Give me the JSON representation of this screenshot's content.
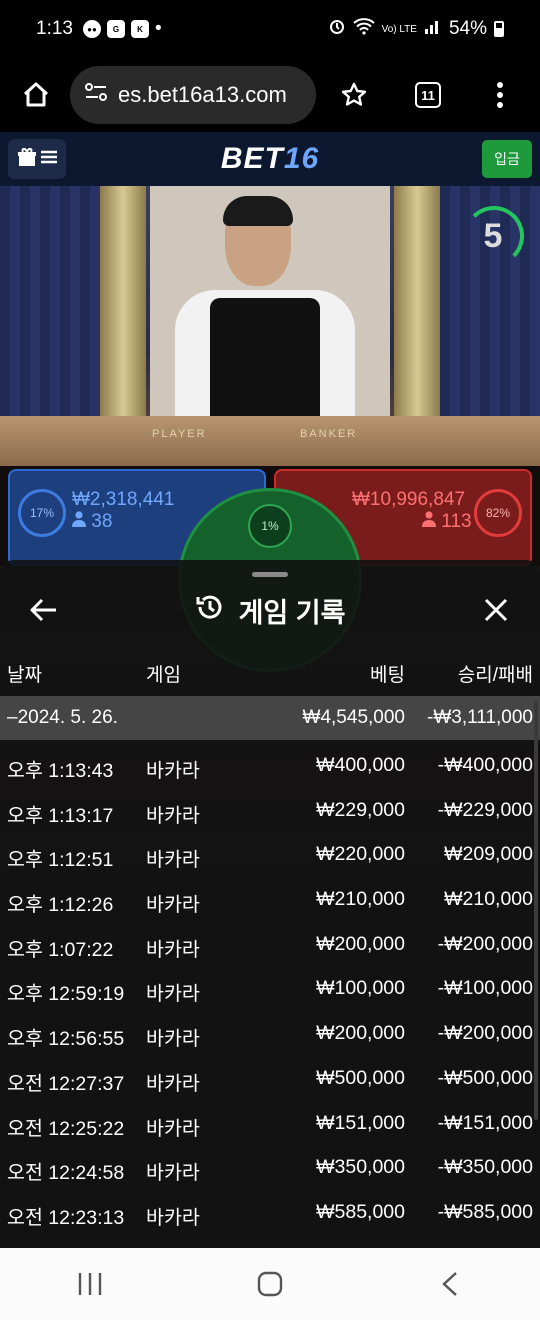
{
  "status": {
    "time": "1:13",
    "notifications": [
      "chat-icon",
      "google-icon",
      "kbank-icon",
      "dot-icon"
    ],
    "right_icons": [
      "alarm-icon",
      "wifi-icon",
      "volte-icon",
      "signal-icon"
    ],
    "volte": "Vo) LTE",
    "battery": "54%"
  },
  "browser": {
    "url": "es.bet16a13.com",
    "tab_count": "11"
  },
  "site": {
    "logo_text": "BET",
    "logo_num": "16",
    "deposit_label": "입금"
  },
  "live": {
    "timer": "5",
    "table_player": "PLAYER",
    "table_banker": "BANKER",
    "player": {
      "percent": "17%",
      "amount": "₩2,318,441",
      "count": "38"
    },
    "tie": {
      "percent": "1%"
    },
    "banker": {
      "percent": "82%",
      "amount": "₩10,996,847",
      "count": "113"
    }
  },
  "history": {
    "title": "게임 기록",
    "columns": {
      "date": "날짜",
      "game": "게임",
      "bet": "베팅",
      "result": "승리/패배"
    },
    "day": {
      "date": "–2024. 5. 26.",
      "bet": "₩4,545,000",
      "result": "-₩3,111,000"
    },
    "rows": [
      {
        "time": "오후 1:13:43",
        "game": "바카라",
        "bet": "₩400,000",
        "result": "-₩400,000"
      },
      {
        "time": "오후 1:13:17",
        "game": "바카라",
        "bet": "₩229,000",
        "result": "-₩229,000"
      },
      {
        "time": "오후 1:12:51",
        "game": "바카라",
        "bet": "₩220,000",
        "result": "₩209,000"
      },
      {
        "time": "오후 1:12:26",
        "game": "바카라",
        "bet": "₩210,000",
        "result": "₩210,000"
      },
      {
        "time": "오후 1:07:22",
        "game": "바카라",
        "bet": "₩200,000",
        "result": "-₩200,000"
      },
      {
        "time": "오후 12:59:19",
        "game": "바카라",
        "bet": "₩100,000",
        "result": "-₩100,000"
      },
      {
        "time": "오후 12:56:55",
        "game": "바카라",
        "bet": "₩200,000",
        "result": "-₩200,000"
      },
      {
        "time": "오전 12:27:37",
        "game": "바카라",
        "bet": "₩500,000",
        "result": "-₩500,000"
      },
      {
        "time": "오전 12:25:22",
        "game": "바카라",
        "bet": "₩151,000",
        "result": "-₩151,000"
      },
      {
        "time": "오전 12:24:58",
        "game": "바카라",
        "bet": "₩350,000",
        "result": "-₩350,000"
      },
      {
        "time": "오전 12:23:13",
        "game": "바카라",
        "bet": "₩585,000",
        "result": "-₩585,000"
      }
    ]
  },
  "colors": {
    "header_bg": "#0c1730",
    "deposit_green": "#1e9a3d",
    "player_blue": "#1e3f7d",
    "banker_red": "#7a1c1c",
    "tie_green": "#14612c",
    "sheet_bg": "#121212"
  }
}
